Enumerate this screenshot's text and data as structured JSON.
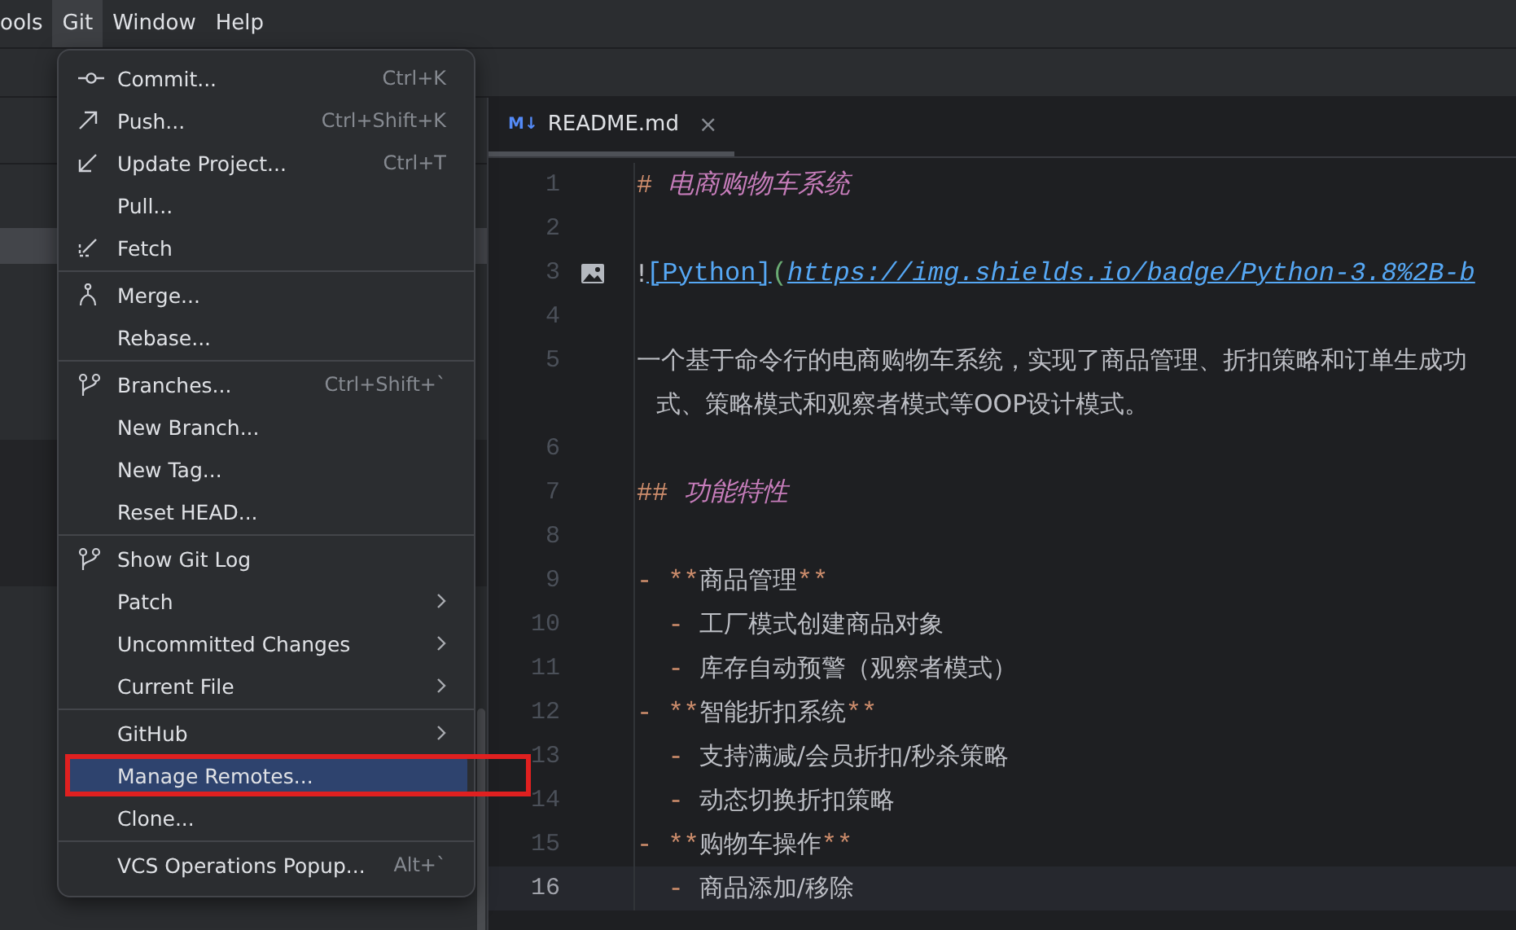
{
  "menu_bar": [
    {
      "label": "ools",
      "selected": false
    },
    {
      "label": "Git",
      "selected": true
    },
    {
      "label": "Window",
      "selected": false
    },
    {
      "label": "Help",
      "selected": false
    }
  ],
  "editor": {
    "tab": {
      "icon_text": "M↓",
      "label": "README.md",
      "close": "×"
    },
    "lines": [
      {
        "number": "1",
        "current": false,
        "segments": [
          {
            "kind": "mark",
            "text": "# "
          },
          {
            "kind": "heading",
            "text": "电商购物车系统"
          }
        ]
      },
      {
        "number": "2",
        "current": false
      },
      {
        "number": "3",
        "current": false,
        "image": true,
        "segments": [
          {
            "kind": "plain",
            "text": "!"
          },
          {
            "kind": "link-text",
            "text": "[Python]"
          },
          {
            "kind": "paren",
            "text": "("
          },
          {
            "kind": "url",
            "text": "https://img.shields.io/badge/Python-3.8%2B-b"
          }
        ]
      },
      {
        "number": "4",
        "current": false
      },
      {
        "number": "5",
        "current": false,
        "segments": [
          {
            "kind": "plain",
            "text": "一个基于命令行的电商购物车系统，实现了商品管理、折扣策略和订单生成功"
          }
        ],
        "wrap": "式、策略模式和观察者模式等OOP设计模式。"
      },
      {
        "number": "6",
        "current": false
      },
      {
        "number": "7",
        "current": false,
        "segments": [
          {
            "kind": "mark",
            "text": "## "
          },
          {
            "kind": "heading",
            "text": "功能特性"
          }
        ]
      },
      {
        "number": "8",
        "current": false
      },
      {
        "number": "9",
        "current": false,
        "segments": [
          {
            "kind": "mark",
            "text": "- "
          },
          {
            "kind": "mark",
            "text": "**"
          },
          {
            "kind": "plain",
            "text": "商品管理"
          },
          {
            "kind": "mark",
            "text": "**"
          }
        ]
      },
      {
        "number": "10",
        "current": false,
        "segments": [
          {
            "kind": "mark",
            "text": "  - "
          },
          {
            "kind": "plain",
            "text": "工厂模式创建商品对象"
          }
        ]
      },
      {
        "number": "11",
        "current": false,
        "segments": [
          {
            "kind": "mark",
            "text": "  - "
          },
          {
            "kind": "plain",
            "text": "库存自动预警（观察者模式）"
          }
        ]
      },
      {
        "number": "12",
        "current": false,
        "segments": [
          {
            "kind": "mark",
            "text": "- "
          },
          {
            "kind": "mark",
            "text": "**"
          },
          {
            "kind": "plain",
            "text": "智能折扣系统"
          },
          {
            "kind": "mark",
            "text": "**"
          }
        ]
      },
      {
        "number": "13",
        "current": false,
        "segments": [
          {
            "kind": "mark",
            "text": "  - "
          },
          {
            "kind": "plain",
            "text": "支持满减/会员折扣/秒杀策略"
          }
        ]
      },
      {
        "number": "14",
        "current": false,
        "segments": [
          {
            "kind": "mark",
            "text": "  - "
          },
          {
            "kind": "plain",
            "text": "动态切换折扣策略"
          }
        ]
      },
      {
        "number": "15",
        "current": false,
        "segments": [
          {
            "kind": "mark",
            "text": "- "
          },
          {
            "kind": "mark",
            "text": "**"
          },
          {
            "kind": "plain",
            "text": "购物车操作"
          },
          {
            "kind": "mark",
            "text": "**"
          }
        ]
      },
      {
        "number": "16",
        "current": true,
        "segments": [
          {
            "kind": "mark",
            "text": "  - "
          },
          {
            "kind": "plain",
            "text": "商品添加/移除"
          }
        ]
      }
    ]
  },
  "git_menu": {
    "groups": [
      {
        "items": [
          {
            "kind": "commit",
            "label": "Commit...",
            "shortcut": "Ctrl+K",
            "submenu": false,
            "selected": false
          },
          {
            "kind": "push",
            "label": "Push...",
            "shortcut": "Ctrl+Shift+K",
            "submenu": false,
            "selected": false
          },
          {
            "kind": "update",
            "label": "Update Project...",
            "shortcut": "Ctrl+T",
            "submenu": false,
            "selected": false
          },
          {
            "label": "Pull...",
            "submenu": false,
            "selected": false
          },
          {
            "kind": "fetch",
            "label": "Fetch",
            "submenu": false,
            "selected": false
          }
        ]
      },
      {
        "items": [
          {
            "kind": "merge",
            "label": "Merge...",
            "submenu": false,
            "selected": false
          },
          {
            "label": "Rebase...",
            "submenu": false,
            "selected": false
          }
        ]
      },
      {
        "items": [
          {
            "kind": "branch",
            "label": "Branches...",
            "shortcut": "Ctrl+Shift+`",
            "submenu": false,
            "selected": false
          },
          {
            "label": "New Branch...",
            "submenu": false,
            "selected": false
          },
          {
            "label": "New Tag...",
            "submenu": false,
            "selected": false
          },
          {
            "label": "Reset HEAD...",
            "submenu": false,
            "selected": false
          }
        ]
      },
      {
        "items": [
          {
            "kind": "branch",
            "label": "Show Git Log",
            "submenu": false,
            "selected": false
          },
          {
            "label": "Patch",
            "submenu": true,
            "selected": false
          },
          {
            "label": "Uncommitted Changes",
            "submenu": true,
            "selected": false
          },
          {
            "label": "Current File",
            "submenu": true,
            "selected": false
          }
        ]
      },
      {
        "items": [
          {
            "label": "GitHub",
            "submenu": true,
            "selected": false
          },
          {
            "label": "Manage Remotes...",
            "submenu": false,
            "selected": true
          },
          {
            "label": "Clone...",
            "submenu": false,
            "selected": false
          }
        ]
      },
      {
        "items": [
          {
            "label": "VCS Operations Popup...",
            "shortcut": "Alt+`",
            "submenu": false,
            "selected": false
          }
        ]
      }
    ]
  }
}
